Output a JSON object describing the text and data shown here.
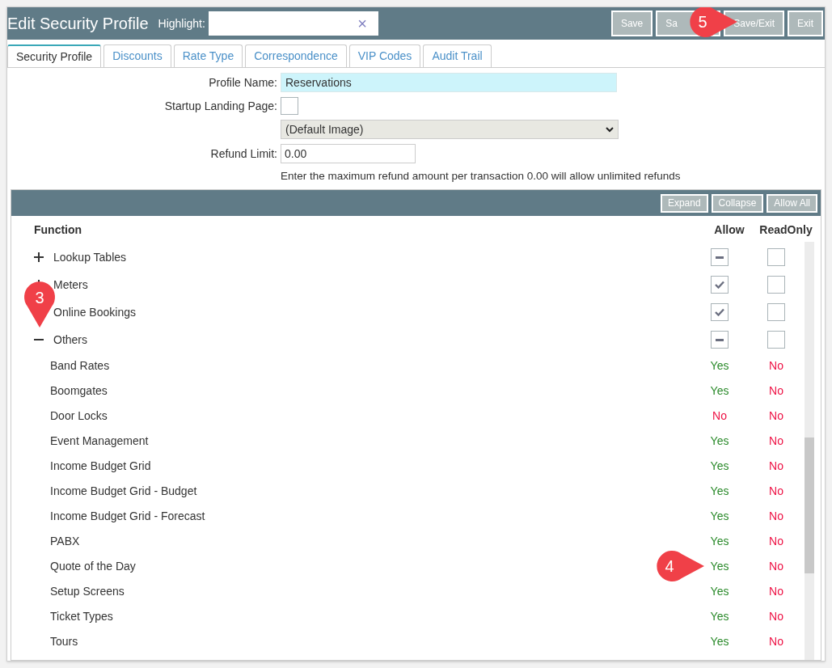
{
  "window": {
    "title": "Edit Security Profile"
  },
  "highlight": {
    "label": "Highlight:",
    "clear": "×"
  },
  "toolbar_buttons": [
    "Save",
    "Sa",
    "Save/Exit",
    "Exit"
  ],
  "tabs": [
    {
      "label": "Security Profile",
      "selected": true
    },
    {
      "label": "Discounts",
      "selected": false
    },
    {
      "label": "Rate Type",
      "selected": false
    },
    {
      "label": "Correspondence",
      "selected": false
    },
    {
      "label": "VIP Codes",
      "selected": false
    },
    {
      "label": "Audit Trail",
      "selected": false
    }
  ],
  "form": {
    "profile_name": {
      "label": "Profile Name:",
      "value": "Reservations"
    },
    "startup_landing_page": {
      "label": "Startup Landing Page:",
      "checked": false,
      "select_value": "(Default Image)"
    },
    "refund_limit": {
      "label": "Refund Limit:",
      "value": "0.00",
      "hint": "Enter the maximum refund amount per transaction 0.00 will allow unlimited refunds"
    }
  },
  "grid_buttons": [
    "Expand",
    "Collapse",
    "Allow All"
  ],
  "columns": [
    "Function",
    "Allow",
    "ReadOnly"
  ],
  "functions": [
    {
      "name": "Lookup Tables",
      "expanded": false,
      "allow_checked": false,
      "allow_partial": true,
      "read_only": false
    },
    {
      "name": "Meters",
      "expanded": false,
      "allow_checked": true,
      "allow_partial": false,
      "read_only": false
    },
    {
      "name": "Online Bookings",
      "expanded": false,
      "allow_checked": true,
      "allow_partial": false,
      "read_only": false
    },
    {
      "name": "Others",
      "expanded": true,
      "allow_checked": false,
      "allow_partial": true,
      "read_only": false,
      "children": [
        {
          "name": "Band Rates",
          "allow": "Yes",
          "allow_granted": true,
          "read_only": "No",
          "read_only_granted": false
        },
        {
          "name": "Boomgates",
          "allow": "Yes",
          "allow_granted": true,
          "read_only": "No",
          "read_only_granted": false
        },
        {
          "name": "Door Locks",
          "allow": "No",
          "allow_granted": false,
          "read_only": "No",
          "read_only_granted": false
        },
        {
          "name": "Event Management",
          "allow": "Yes",
          "allow_granted": true,
          "read_only": "No",
          "read_only_granted": false
        },
        {
          "name": "Income Budget Grid",
          "allow": "Yes",
          "allow_granted": true,
          "read_only": "No",
          "read_only_granted": false
        },
        {
          "name": "Income Budget Grid - Budget",
          "allow": "Yes",
          "allow_granted": true,
          "read_only": "No",
          "read_only_granted": false
        },
        {
          "name": "Income Budget Grid - Forecast",
          "allow": "Yes",
          "allow_granted": true,
          "read_only": "No",
          "read_only_granted": false
        },
        {
          "name": "PABX",
          "allow": "Yes",
          "allow_granted": true,
          "read_only": "No",
          "read_only_granted": false
        },
        {
          "name": "Quote of the Day",
          "allow": "Yes",
          "allow_granted": true,
          "read_only": "No",
          "read_only_granted": false
        },
        {
          "name": "Setup Screens",
          "allow": "Yes",
          "allow_granted": true,
          "read_only": "No",
          "read_only_granted": false
        },
        {
          "name": "Ticket Types",
          "allow": "Yes",
          "allow_granted": true,
          "read_only": "No",
          "read_only_granted": false
        },
        {
          "name": "Tours",
          "allow": "Yes",
          "allow_granted": true,
          "read_only": "No",
          "read_only_granted": false
        }
      ]
    }
  ],
  "callouts": [
    "3",
    "4",
    "5"
  ]
}
